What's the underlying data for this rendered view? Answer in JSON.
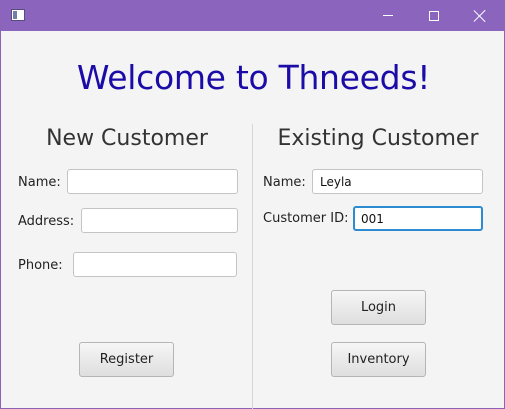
{
  "window": {
    "title": "",
    "icons": {
      "app": "app-icon",
      "minimize": "minimize-icon",
      "maximize": "maximize-icon",
      "close": "close-icon"
    },
    "colors": {
      "titlebar": "#8a64bd",
      "heading": "#1b0ca8",
      "focus": "#2d8bd2"
    }
  },
  "welcome": "Welcome to Thneeds!",
  "new_customer": {
    "title": "New Customer",
    "name_label": "Name:",
    "name_value": "",
    "address_label": "Address:",
    "address_value": "",
    "phone_label": "Phone:",
    "phone_value": "",
    "register_label": "Register"
  },
  "existing_customer": {
    "title": "Existing Customer",
    "name_label": "Name:",
    "name_value": "Leyla",
    "id_label": "Customer ID:",
    "id_value": "001",
    "login_label": "Login",
    "inventory_label": "Inventory"
  }
}
